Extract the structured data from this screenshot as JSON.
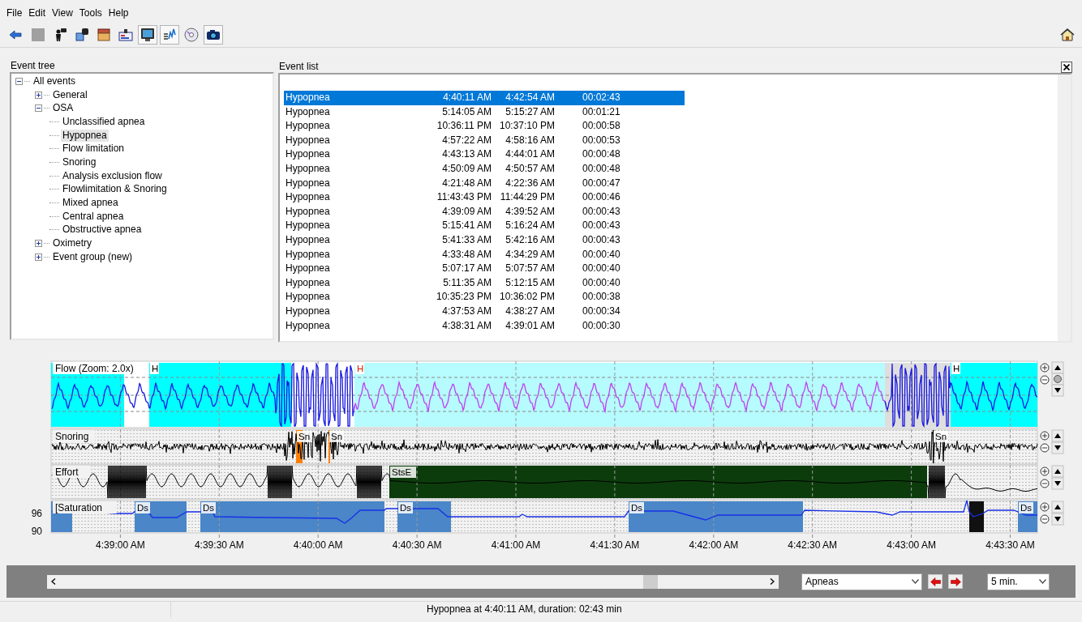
{
  "menu": [
    "File",
    "Edit",
    "View",
    "Tools",
    "Help"
  ],
  "toolbar": [
    {
      "kind": "back-arrow",
      "pressed": false
    },
    {
      "kind": "stop",
      "pressed": false
    },
    {
      "kind": "person",
      "pressed": false
    },
    {
      "kind": "device",
      "pressed": false
    },
    {
      "kind": "box",
      "pressed": false
    },
    {
      "kind": "card",
      "pressed": false
    },
    {
      "kind": "monitor",
      "pressed": true
    },
    {
      "kind": "chart",
      "pressed": true
    },
    {
      "kind": "disc",
      "pressed": false
    },
    {
      "kind": "camera",
      "pressed": true
    }
  ],
  "event_tree": {
    "title": "Event tree",
    "items": [
      {
        "label": "All events",
        "expanded": true,
        "selected": false,
        "children": [
          {
            "label": "General",
            "expanded": false,
            "selected": false
          },
          {
            "label": "OSA",
            "expanded": true,
            "selected": false,
            "children": [
              {
                "label": "Unclassified apnea",
                "selected": false
              },
              {
                "label": "Hypopnea",
                "selected": true
              },
              {
                "label": "Flow limitation",
                "selected": false
              },
              {
                "label": "Snoring",
                "selected": false
              },
              {
                "label": "Analysis exclusion flow",
                "selected": false
              },
              {
                "label": "Flowlimitation & Snoring",
                "selected": false
              },
              {
                "label": "Mixed apnea",
                "selected": false
              },
              {
                "label": "Central apnea",
                "selected": false
              },
              {
                "label": "Obstructive apnea",
                "selected": false
              }
            ]
          },
          {
            "label": "Oximetry",
            "expanded": false,
            "selected": false
          },
          {
            "label": "Event group (new)",
            "expanded": false,
            "selected": false
          }
        ]
      }
    ]
  },
  "event_list": {
    "title": "Event list",
    "rows": [
      {
        "event": "Hypopnea",
        "start": "4:40:11 AM",
        "end": "4:42:54 AM",
        "duration": "00:02:43",
        "selected": true
      },
      {
        "event": "Hypopnea",
        "start": "5:14:05 AM",
        "end": "5:15:27 AM",
        "duration": "00:01:21",
        "selected": false
      },
      {
        "event": "Hypopnea",
        "start": "10:36:11 PM",
        "end": "10:37:10 PM",
        "duration": "00:00:58",
        "selected": false
      },
      {
        "event": "Hypopnea",
        "start": "4:57:22 AM",
        "end": "4:58:16 AM",
        "duration": "00:00:53",
        "selected": false
      },
      {
        "event": "Hypopnea",
        "start": "4:43:13 AM",
        "end": "4:44:01 AM",
        "duration": "00:00:48",
        "selected": false
      },
      {
        "event": "Hypopnea",
        "start": "4:50:09 AM",
        "end": "4:50:57 AM",
        "duration": "00:00:48",
        "selected": false
      },
      {
        "event": "Hypopnea",
        "start": "4:21:48 AM",
        "end": "4:22:36 AM",
        "duration": "00:00:47",
        "selected": false
      },
      {
        "event": "Hypopnea",
        "start": "11:43:43 PM",
        "end": "11:44:29 PM",
        "duration": "00:00:46",
        "selected": false
      },
      {
        "event": "Hypopnea",
        "start": "4:39:09 AM",
        "end": "4:39:52 AM",
        "duration": "00:00:43",
        "selected": false
      },
      {
        "event": "Hypopnea",
        "start": "5:15:41 AM",
        "end": "5:16:24 AM",
        "duration": "00:00:43",
        "selected": false
      },
      {
        "event": "Hypopnea",
        "start": "5:41:33 AM",
        "end": "5:42:16 AM",
        "duration": "00:00:43",
        "selected": false
      },
      {
        "event": "Hypopnea",
        "start": "4:33:48 AM",
        "end": "4:34:29 AM",
        "duration": "00:00:40",
        "selected": false
      },
      {
        "event": "Hypopnea",
        "start": "5:07:17 AM",
        "end": "5:07:57 AM",
        "duration": "00:00:40",
        "selected": false
      },
      {
        "event": "Hypopnea",
        "start": "5:11:35 AM",
        "end": "5:12:15 AM",
        "duration": "00:00:40",
        "selected": false
      },
      {
        "event": "Hypopnea",
        "start": "10:35:23 PM",
        "end": "10:36:02 PM",
        "duration": "00:00:38",
        "selected": false
      },
      {
        "event": "Hypopnea",
        "start": "4:37:53 AM",
        "end": "4:38:27 AM",
        "duration": "00:00:34",
        "selected": false
      },
      {
        "event": "Hypopnea",
        "start": "4:38:31 AM",
        "end": "4:39:01 AM",
        "duration": "00:00:30",
        "selected": false
      }
    ]
  },
  "chart": {
    "ticks": [
      "4:39:00 AM",
      "4:39:30 AM",
      "4:40:00 AM",
      "4:40:30 AM",
      "4:41:00 AM",
      "4:41:30 AM",
      "4:42:00 AM",
      "4:42:30 AM",
      "4:43:00 AM",
      "4:43:30 AM"
    ],
    "channels": [
      {
        "kind": "flow",
        "title": "Flow (Zoom: 2.0x)",
        "bands": [
          {
            "color": "#00ffff",
            "selected": false
          },
          {
            "label": "H",
            "color": "#00ffff",
            "selected": false
          },
          {
            "label": "H",
            "color": "#b6fbfe",
            "selected": true
          },
          {
            "color": "#dedede",
            "selected": false
          },
          {
            "label": "H",
            "color": "#00ffff",
            "selected": false
          }
        ]
      },
      {
        "kind": "snoring",
        "title": "Snoring",
        "bands": [
          {
            "label": "Sn",
            "color": "#ff8000"
          },
          {
            "label": "Sn",
            "color": "#ff8000"
          },
          {
            "label": "Sn",
            "color": "#000000"
          }
        ]
      },
      {
        "kind": "effort",
        "title": "Effort",
        "bands": [
          {
            "label": "StsE",
            "color": "#0c3c0c"
          }
        ]
      },
      {
        "kind": "saturation",
        "title": "[Saturation",
        "ticks": [
          "96",
          "90"
        ],
        "bands": [
          {
            "color": "#4a86c8"
          },
          {
            "label": "Ds",
            "color": "#4a86c8"
          },
          {
            "label": "Ds",
            "color": "#4a86c8"
          },
          {
            "label": "Ds",
            "color": "#4a86c8"
          },
          {
            "label": "Ds",
            "color": "#4a86c8"
          },
          {
            "color": "#111111"
          },
          {
            "label": "Ds",
            "color": "#4a86c8"
          }
        ]
      }
    ]
  },
  "navigator": {
    "event_type": "Apneas",
    "window": "5 min."
  },
  "status": "Hypopnea at 4:40:11 AM, duration: 02:43 min"
}
